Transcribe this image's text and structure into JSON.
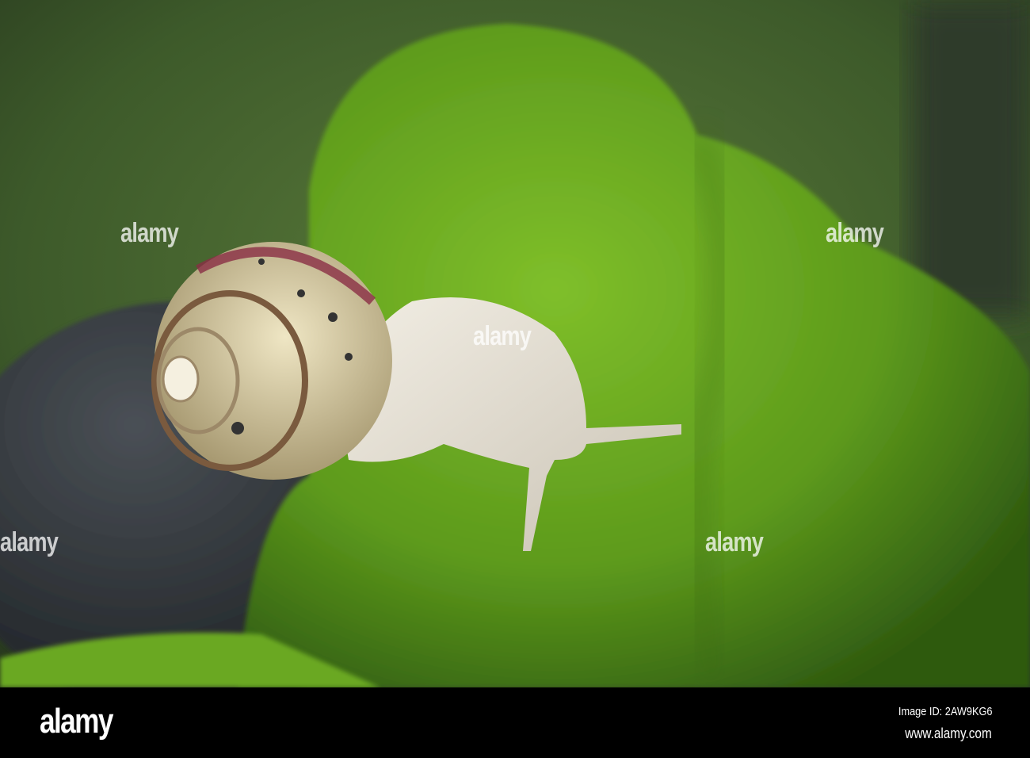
{
  "photo": {
    "subject": "snail-on-moss"
  },
  "watermark": {
    "logo_text": "alamy"
  },
  "footer": {
    "logo": "alamy",
    "image_id": "Image ID: 2AW9KG6",
    "url": "www.alamy.com"
  },
  "colors": {
    "moss": "#5f9a1e",
    "background": "#3f5a2a",
    "rock": "#2b2f33",
    "shell": "#d9cfa8",
    "body": "#e6e0d2"
  }
}
